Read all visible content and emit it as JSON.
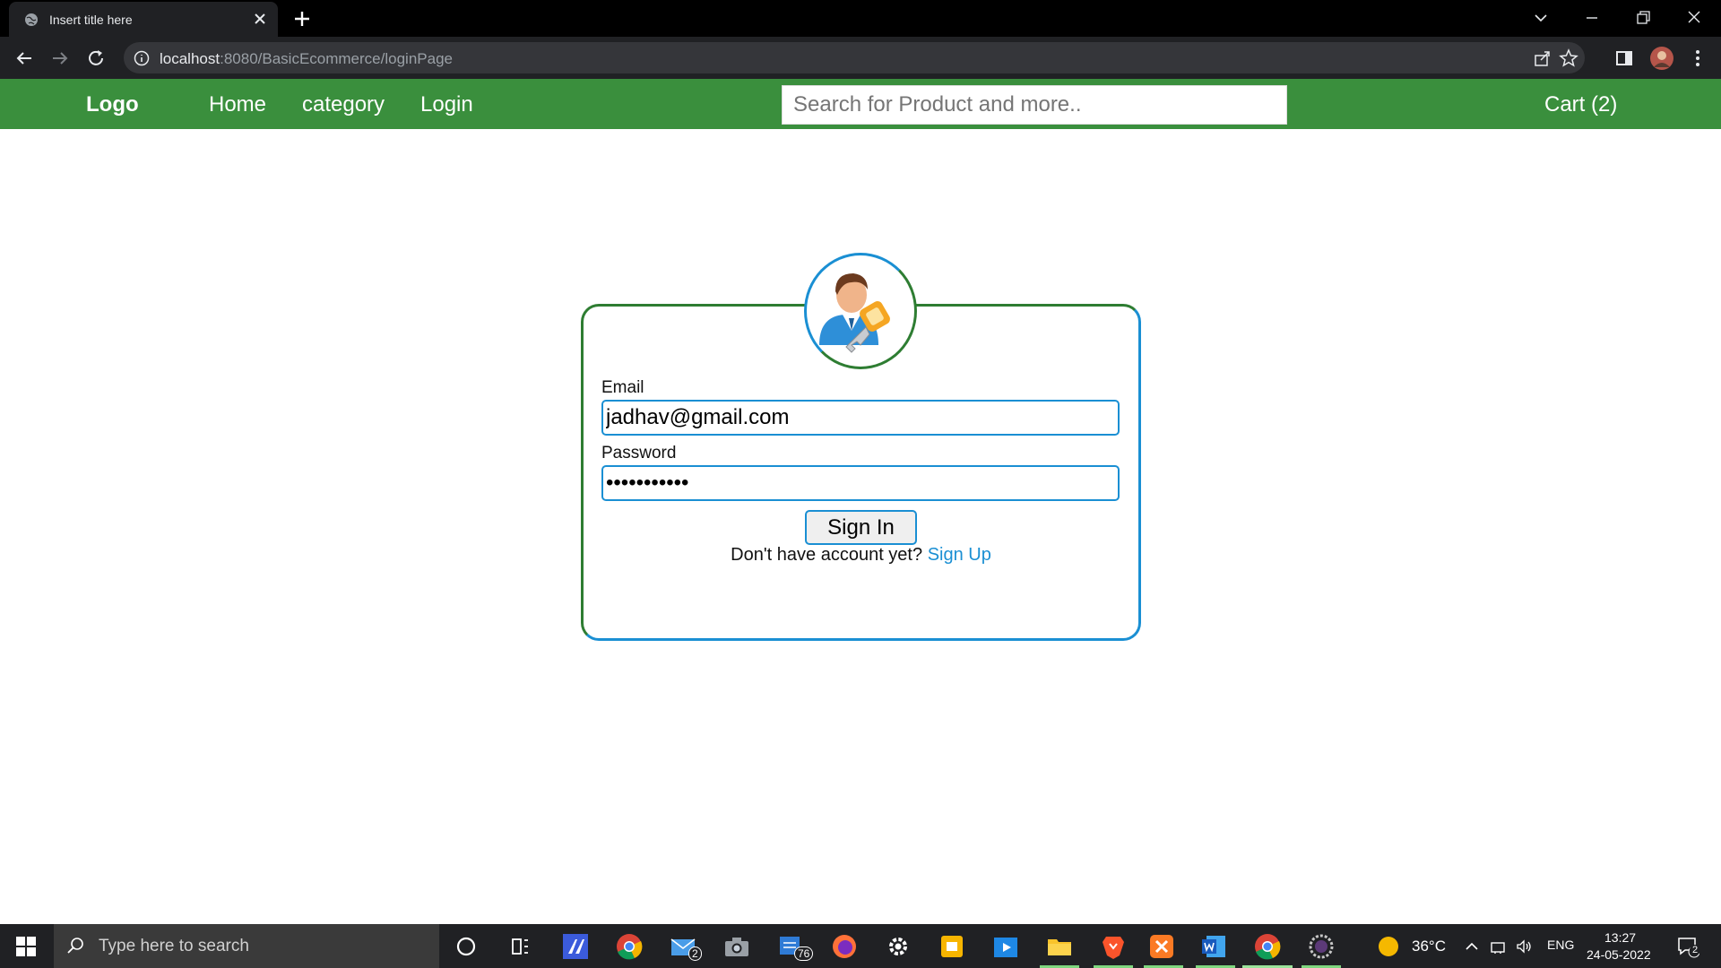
{
  "browser": {
    "tab_title": "Insert title here",
    "url_host": "localhost",
    "url_path": ":8080/BasicEcommerce/loginPage"
  },
  "navbar": {
    "brand": "Logo",
    "links": [
      "Home",
      "category",
      "Login"
    ],
    "search_placeholder": "Search for Product and more..",
    "cart": "Cart (2)"
  },
  "login": {
    "email_label": "Email",
    "email_value": "jadhav@gmail.com",
    "password_label": "Password",
    "password_value": "jadhav12345",
    "signin_label": "Sign In",
    "signup_prompt": "Don't have account yet?",
    "signup_link": "Sign Up"
  },
  "colors": {
    "navbar_green": "#3a8f3d",
    "accent_blue": "#1a8fd3",
    "border_green": "#2e7d32"
  },
  "taskbar": {
    "search_placeholder": "Type here to search",
    "mail_badge": "2",
    "tasks_badge": "76",
    "weather_temp": "36°C",
    "language": "ENG",
    "time": "13:27",
    "date": "24-05-2022",
    "notification_count": "2"
  }
}
